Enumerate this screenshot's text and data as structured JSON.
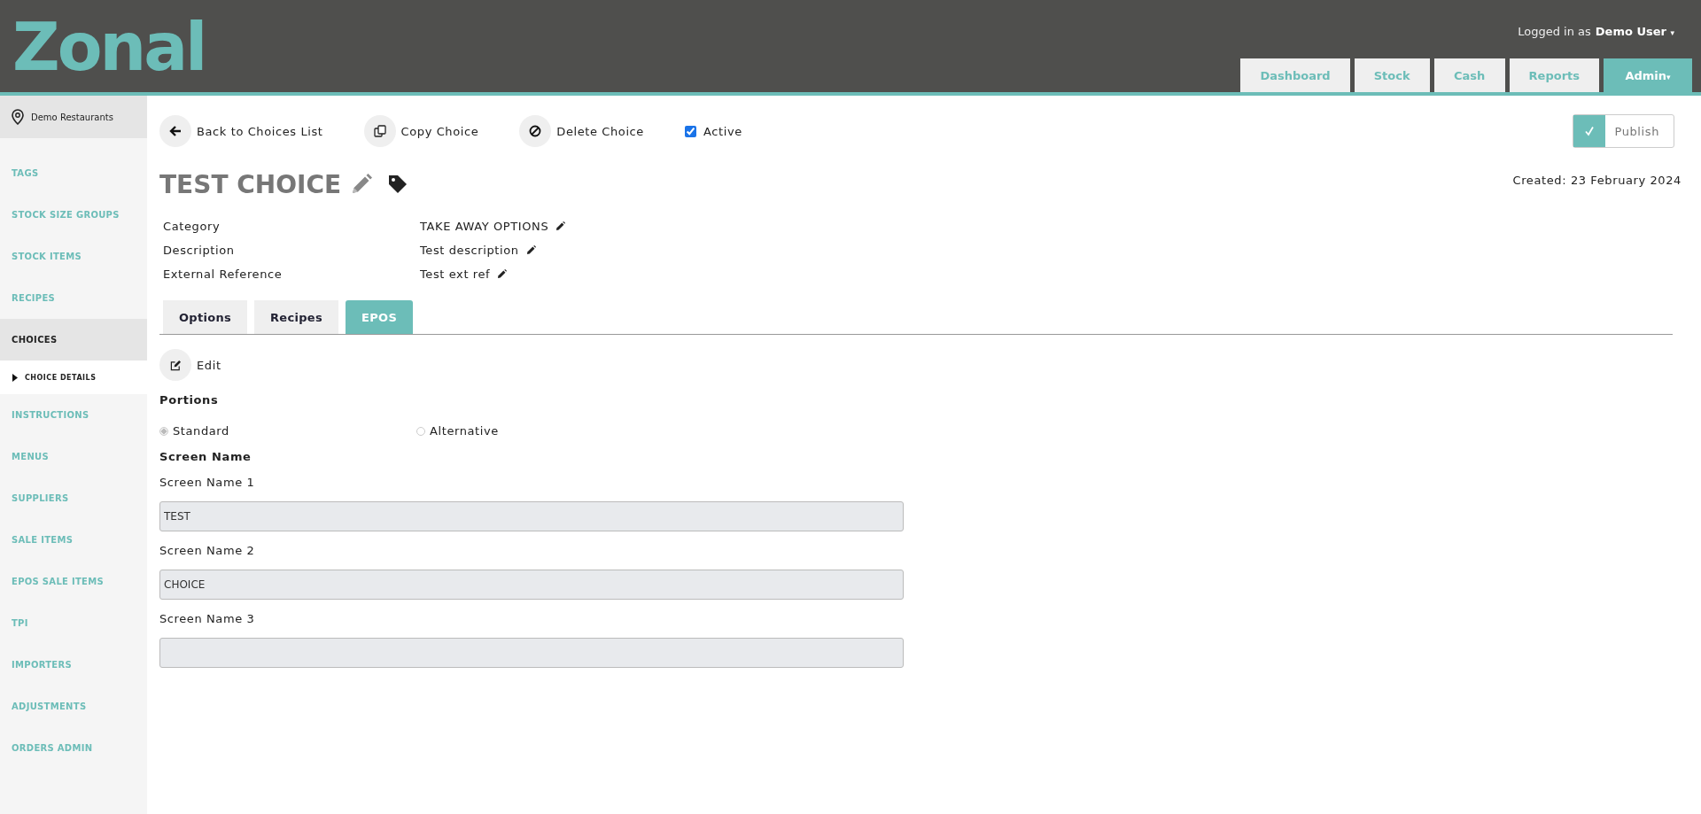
{
  "header": {
    "logo": "Zonal",
    "user_prefix": "Logged in as",
    "user_name": "Demo User",
    "caret": "▾",
    "nav": [
      {
        "label": "Dashboard",
        "selected": false
      },
      {
        "label": "Stock",
        "selected": false
      },
      {
        "label": "Cash",
        "selected": false
      },
      {
        "label": "Reports",
        "selected": false
      },
      {
        "label": "Admin",
        "selected": true,
        "caret": "▾"
      }
    ]
  },
  "sidebar": {
    "location": "Demo Restaurants",
    "items": [
      {
        "label": "TAGS",
        "selected": false
      },
      {
        "label": "STOCK SIZE GROUPS",
        "selected": false
      },
      {
        "label": "STOCK ITEMS",
        "selected": false
      },
      {
        "label": "RECIPES",
        "selected": false
      },
      {
        "label": "CHOICES",
        "selected": true,
        "children": [
          {
            "label": "CHOICE DETAILS",
            "selected": true
          }
        ]
      },
      {
        "label": "INSTRUCTIONS",
        "selected": false
      },
      {
        "label": "MENUS",
        "selected": false
      },
      {
        "label": "SUPPLIERS",
        "selected": false
      },
      {
        "label": "SALE ITEMS",
        "selected": false
      },
      {
        "label": "EPOS SALE ITEMS",
        "selected": false
      },
      {
        "label": "TPI",
        "selected": false
      },
      {
        "label": "IMPORTERS",
        "selected": false
      },
      {
        "label": "ADJUSTMENTS",
        "selected": false
      },
      {
        "label": "ORDERS ADMIN",
        "selected": false
      }
    ]
  },
  "toolbar": {
    "actions": [
      {
        "kind": "back",
        "label": "Back to Choices List"
      },
      {
        "kind": "copy",
        "label": "Copy Choice"
      },
      {
        "kind": "delete",
        "label": "Delete Choice"
      }
    ],
    "active": {
      "label": "Active",
      "checked": true
    },
    "publish": {
      "label": "Publish",
      "on": true
    }
  },
  "title": "TEST CHOICE",
  "created": "Created: 23 February 2024",
  "details": [
    {
      "label": "Category",
      "value": "TAKE AWAY OPTIONS"
    },
    {
      "label": "Description",
      "value": "Test description"
    },
    {
      "label": "External Reference",
      "value": "Test ext ref"
    }
  ],
  "tabs": [
    {
      "label": "Options",
      "selected": false
    },
    {
      "label": "Recipes",
      "selected": false
    },
    {
      "label": "EPOS",
      "selected": true
    }
  ],
  "edit_button": "Edit",
  "portions": {
    "heading": "Portions",
    "options": [
      {
        "label": "Standard",
        "selected": true
      },
      {
        "label": "Alternative",
        "selected": false
      }
    ]
  },
  "screen_name": {
    "heading": "Screen Name",
    "fields": [
      {
        "label": "Screen Name 1",
        "value": "TEST"
      },
      {
        "label": "Screen Name 2",
        "value": "CHOICE"
      },
      {
        "label": "Screen Name 3"
      }
    ]
  }
}
